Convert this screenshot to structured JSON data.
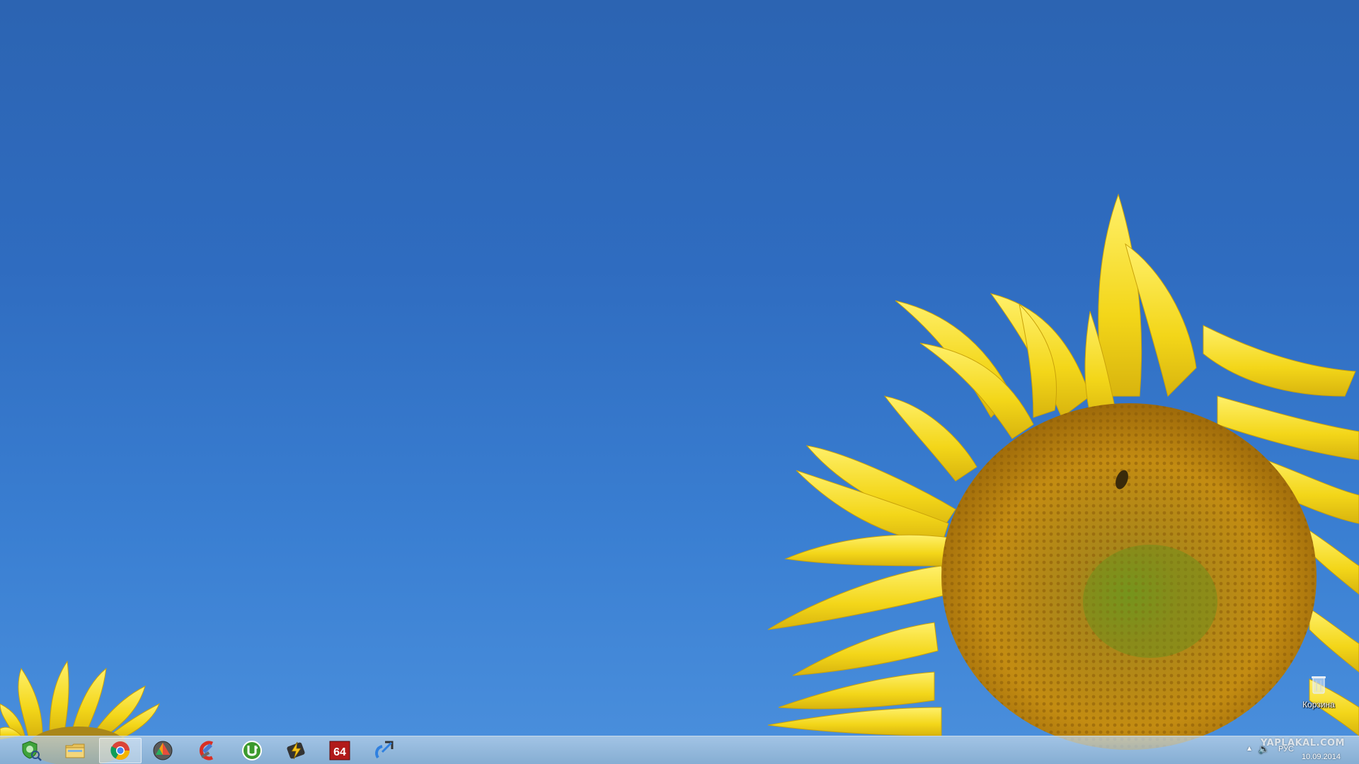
{
  "desktop": {
    "wallpaper": "sunflower-on-blue-sky",
    "icons": [
      {
        "label": "Корзина",
        "icon": "recycle-bin-icon"
      }
    ]
  },
  "taskbar": {
    "pinned": [
      {
        "name": "security-app",
        "icon": "shield-magnifier-icon",
        "active": false
      },
      {
        "name": "file-explorer",
        "icon": "folder-icon",
        "active": false
      },
      {
        "name": "chrome",
        "icon": "chrome-icon",
        "active": true
      },
      {
        "name": "media-player",
        "icon": "media-player-icon",
        "active": false
      },
      {
        "name": "ccleaner",
        "icon": "ccleaner-icon",
        "active": false
      },
      {
        "name": "utorrent",
        "icon": "utorrent-icon",
        "active": false
      },
      {
        "name": "winamp",
        "icon": "winamp-lightning-icon",
        "active": false
      },
      {
        "name": "aida64",
        "icon": "aida64-icon",
        "active": false
      },
      {
        "name": "app-arrow",
        "icon": "arrow-app-icon",
        "active": false
      }
    ],
    "aida64_label": "64",
    "tray": {
      "language": "РУС",
      "date": "10.09.2014"
    },
    "watermark": "YAPLAKAL.COM"
  },
  "colors": {
    "sky_top": "#2c64b2",
    "sky_bottom": "#4b90dd",
    "petal": "#f2d81e",
    "seed": "#b8860b"
  }
}
